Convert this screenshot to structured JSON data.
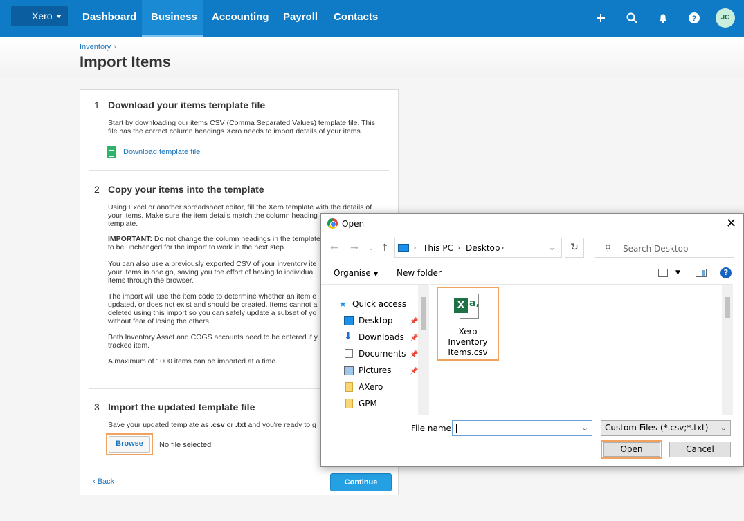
{
  "nav": {
    "org": "Xero",
    "tabs": [
      "Dashboard",
      "Business",
      "Accounting",
      "Payroll",
      "Contacts"
    ],
    "active_tab": "Business",
    "avatar": "JC",
    "icons": [
      "plus-icon",
      "search-icon",
      "bell-icon",
      "help-icon"
    ]
  },
  "page": {
    "breadcrumb": "Inventory",
    "title": "Import Items"
  },
  "steps": {
    "s1": {
      "num": "1",
      "title": "Download your items template file",
      "desc": "Start by downloading our items CSV (Comma Separated Values) template file. This file has the correct column headings Xero needs to import details of your items.",
      "link": "Download template file"
    },
    "s2": {
      "num": "2",
      "title": "Copy your items into the template",
      "p1": "Using Excel or another spreadsheet editor, fill the Xero template with the details of your items. Make sure the item details match the column heading",
      "p1b": "template.",
      "p2_bold": "IMPORTANT:",
      "p2": " Do not change the column headings in the template",
      "p2b": "to be unchanged for the import to work in the next step.",
      "p3": "You can also use a previously exported CSV of your inventory ite",
      "p3b": "your items in one go, saving you the effort of having to individual",
      "p3c": "items through the browser.",
      "p4": "The import will use the item code to determine whether an item e",
      "p4b": "updated, or does not exist and should be created. Items cannot a",
      "p4c": "deleted using this import so you can safely update a subset of yo",
      "p4d": "without fear of losing the others.",
      "p5": "Both Inventory Asset and COGS accounts need to be entered if y",
      "p5b": "tracked item.",
      "p6": "A maximum of 1000 items can be imported at a time."
    },
    "s3": {
      "num": "3",
      "title": "Import the updated template file",
      "desc_pre": "Save your updated template as ",
      "csv": ".csv",
      "or": " or ",
      "txt": ".txt",
      "desc_post": " and you're ready to g",
      "browse": "Browse",
      "nofile": "No file selected"
    }
  },
  "footer": {
    "back": "‹ Back",
    "continue": "Continue"
  },
  "dialog": {
    "title": "Open",
    "path": [
      "This PC",
      "Desktop"
    ],
    "search_placeholder": "Search Desktop",
    "organise": "Organise",
    "new_folder": "New folder",
    "nav_items": [
      {
        "label": "Quick access",
        "icon": "star-icon"
      },
      {
        "label": "Desktop",
        "icon": "desktop-icon",
        "pinned": true
      },
      {
        "label": "Downloads",
        "icon": "download-icon",
        "pinned": true
      },
      {
        "label": "Documents",
        "icon": "documents-icon",
        "pinned": true
      },
      {
        "label": "Pictures",
        "icon": "pictures-icon",
        "pinned": true
      },
      {
        "label": "AXero",
        "icon": "folder-icon"
      },
      {
        "label": "GPM",
        "icon": "folder-icon"
      }
    ],
    "file": {
      "line1": "Xero",
      "line2": "Inventory",
      "line3": "Items.csv"
    },
    "filename_label": "File name:",
    "filename_value": "",
    "filter": "Custom Files (*.csv;*.txt)",
    "open": "Open",
    "cancel": "Cancel"
  }
}
